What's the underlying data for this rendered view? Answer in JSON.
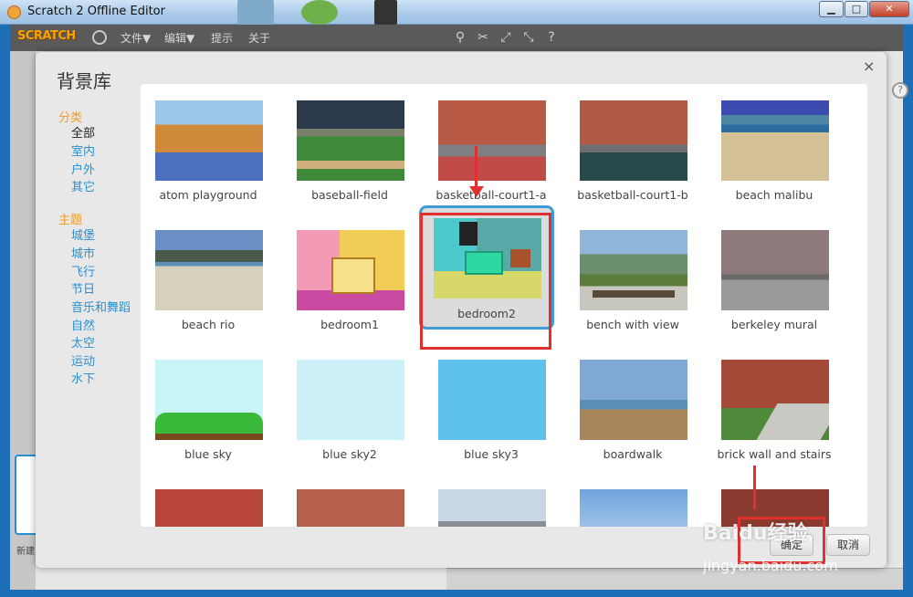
{
  "window": {
    "title": "Scratch 2 Offline Editor",
    "min": "▁",
    "max": "□",
    "close": "✕"
  },
  "menubar": {
    "logo": "SCRATCH",
    "items": [
      "文件▼",
      "编辑▼",
      "提示",
      "关于"
    ]
  },
  "dialog": {
    "title": "背景库",
    "close": "×",
    "category_heading": "分类",
    "categories": [
      "全部",
      "室内",
      "户外",
      "其它"
    ],
    "theme_heading": "主题",
    "themes": [
      "城堡",
      "城市",
      "飞行",
      "节日",
      "音乐和舞蹈",
      "自然",
      "太空",
      "运动",
      "水下"
    ],
    "tiles": [
      "atom playground",
      "baseball-field",
      "basketball-court1-a",
      "basketball-court1-b",
      "beach malibu",
      "beach rio",
      "bedroom1",
      "bedroom2",
      "bench with view",
      "berkeley mural",
      "blue sky",
      "blue sky2",
      "blue sky3",
      "boardwalk",
      "brick wall and stairs"
    ],
    "ok_label": "确定",
    "cancel_label": "取消"
  },
  "editor": {
    "new_label": "新建"
  },
  "watermark": {
    "brand": "Baidu经验",
    "url": "jingyan.baidu.com"
  },
  "colors": {
    "accent": "#3e9bd7",
    "heading": "#f29a2c",
    "link": "#2a8fd1",
    "annotation": "#e03030"
  }
}
